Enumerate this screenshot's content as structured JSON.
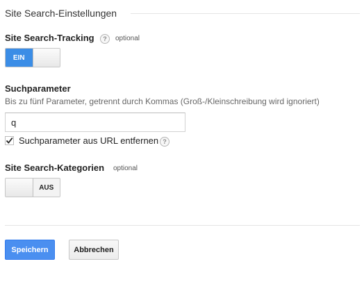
{
  "section": {
    "title": "Site Search-Einstellungen"
  },
  "tracking": {
    "label": "Site Search-Tracking",
    "help_icon": "question-mark-icon",
    "help_glyph": "?",
    "optional": "optional",
    "toggle_on_label": "EIN",
    "state": "on"
  },
  "query_param": {
    "label": "Suchparameter",
    "description": "Bis zu fünf Parameter, getrennt durch Kommas (Groß-/Kleinschreibung wird ignoriert)",
    "value": "q",
    "strip_checkbox": {
      "checked": true,
      "label": "Suchparameter aus URL entfernen",
      "help_glyph": "?"
    }
  },
  "categories": {
    "label": "Site Search-Kategorien",
    "optional": "optional",
    "toggle_off_label": "AUS",
    "state": "off"
  },
  "actions": {
    "save_label": "Speichern",
    "cancel_label": "Abbrechen"
  },
  "colors": {
    "accent": "#3b8de6",
    "primary_button": "#4a8ff0"
  }
}
